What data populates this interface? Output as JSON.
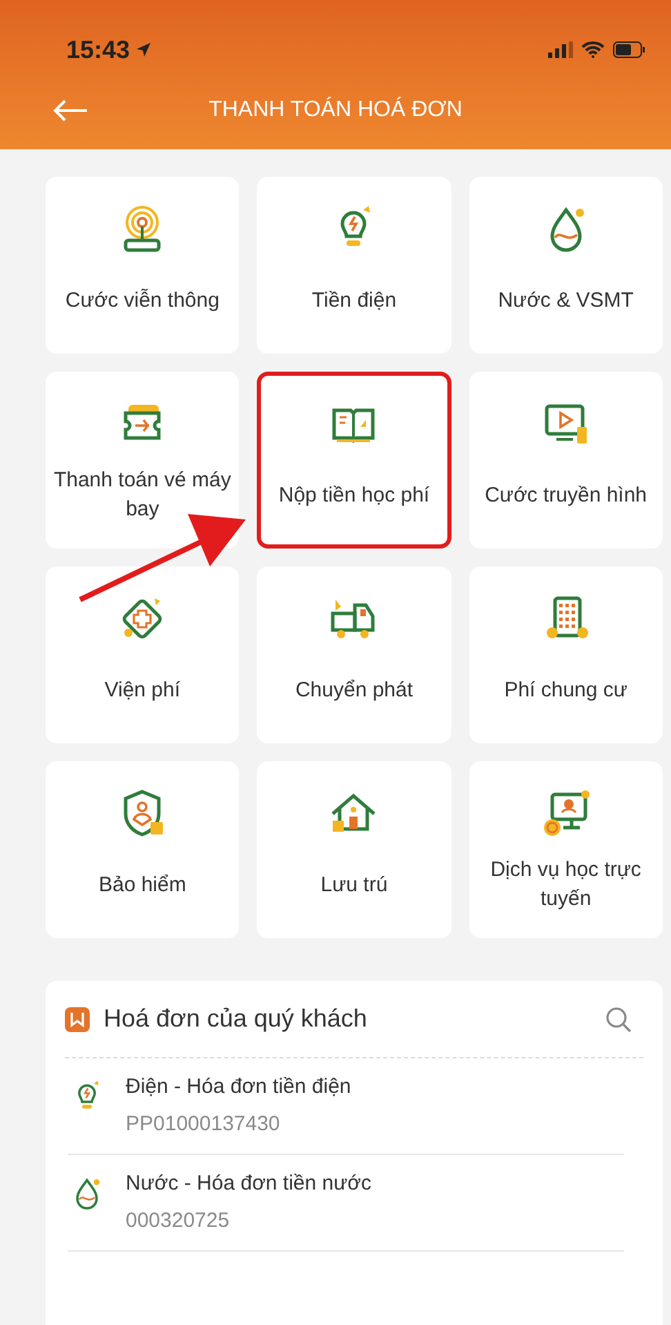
{
  "status_bar": {
    "time": "15:43"
  },
  "header": {
    "title": "THANH TOÁN HOÁ ĐƠN"
  },
  "services": [
    {
      "kind": "telecom",
      "label": "Cước viễn thông",
      "highlighted": false
    },
    {
      "kind": "electricity",
      "label": "Tiền điện",
      "highlighted": false
    },
    {
      "kind": "water",
      "label": "Nước & VSMT",
      "highlighted": false
    },
    {
      "kind": "flight",
      "label": "Thanh toán vé máy bay",
      "highlighted": false
    },
    {
      "kind": "book",
      "label": "Nộp tiền học phí",
      "highlighted": true
    },
    {
      "kind": "tv",
      "label": "Cước truyền hình",
      "highlighted": false
    },
    {
      "kind": "hospital",
      "label": "Viện phí",
      "highlighted": false
    },
    {
      "kind": "delivery",
      "label": "Chuyển phát",
      "highlighted": false
    },
    {
      "kind": "building",
      "label": "Phí chung cư",
      "highlighted": false
    },
    {
      "kind": "insurance",
      "label": "Bảo hiểm",
      "highlighted": false
    },
    {
      "kind": "house",
      "label": "Lưu trú",
      "highlighted": false
    },
    {
      "kind": "elearning",
      "label": "Dịch vụ học trực tuyến",
      "highlighted": false
    }
  ],
  "bills": {
    "title": "Hoá đơn của quý khách",
    "items": [
      {
        "kind": "electricity",
        "name": "Điện - Hóa đơn tiền điện",
        "code": "PP01000137430"
      },
      {
        "kind": "water",
        "name": "Nước - Hóa đơn tiền nước",
        "code": "000320725"
      }
    ]
  }
}
